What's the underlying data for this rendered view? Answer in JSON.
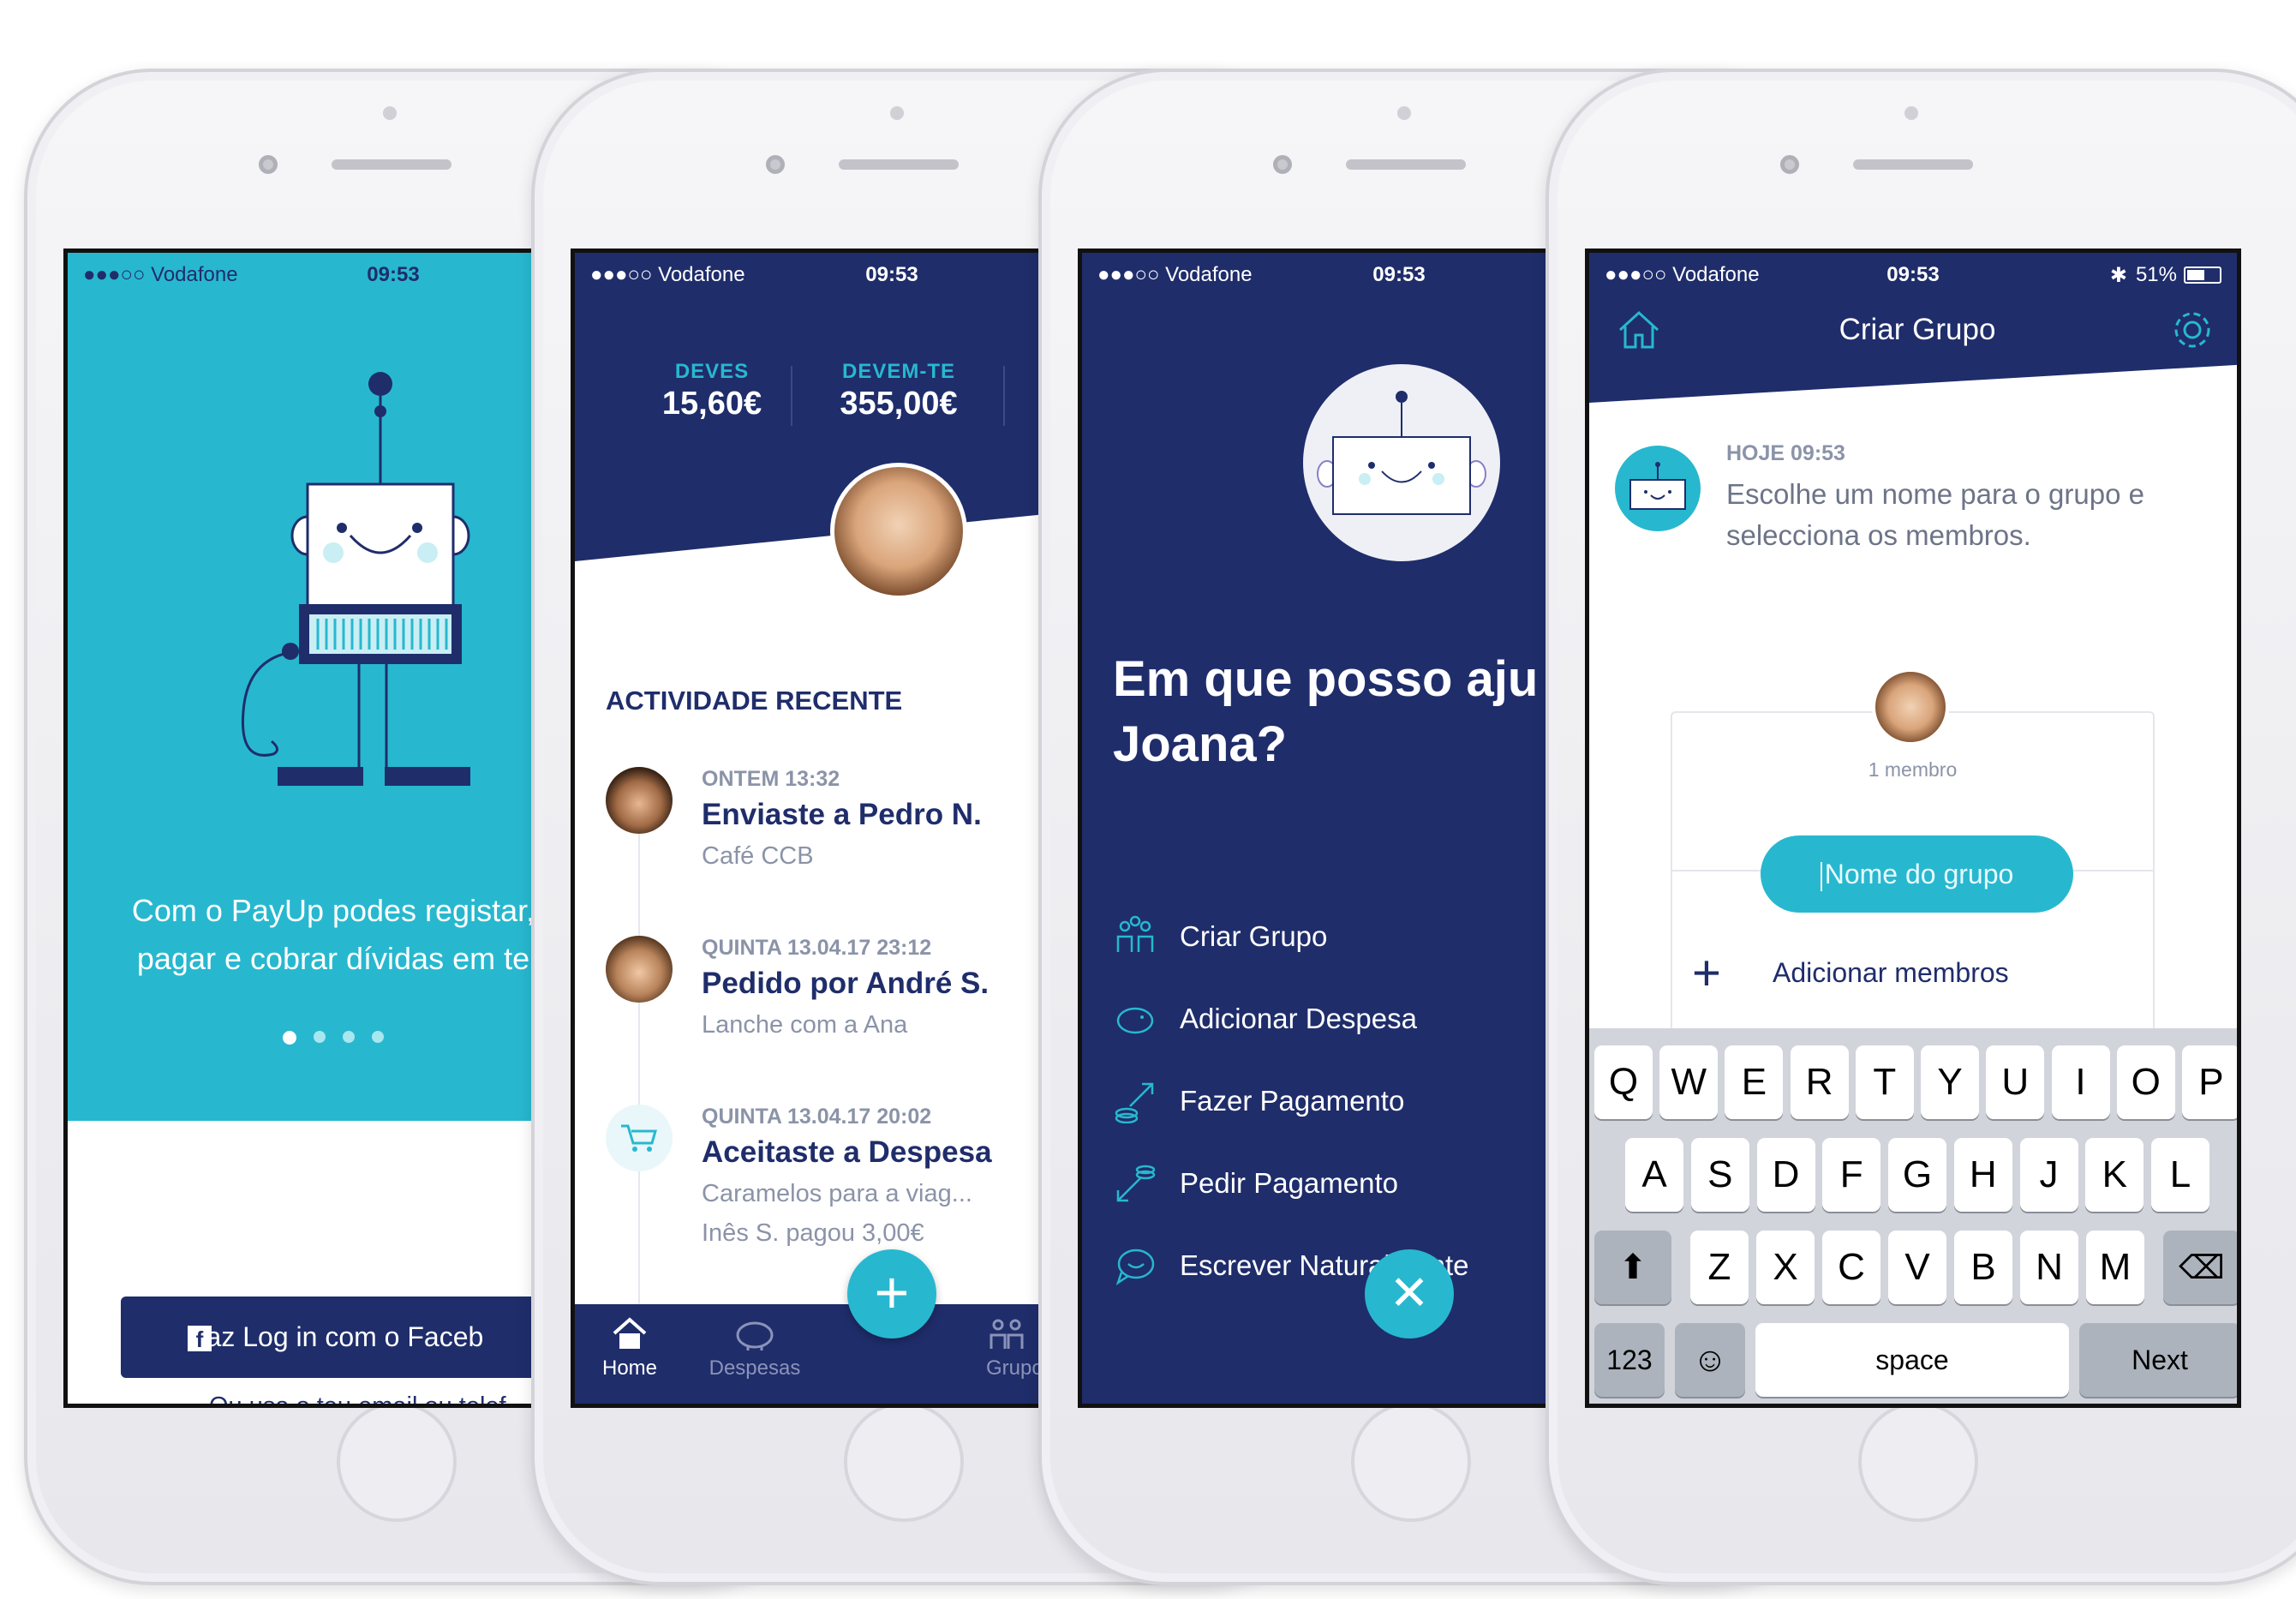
{
  "colors": {
    "teal": "#27b8cf",
    "navy": "#1f2d6b",
    "grey_text": "#8b93a8",
    "light_teal": "#c9eef4"
  },
  "status": {
    "carrier": "●●●○○ Vodafone",
    "time": "09:53",
    "battery": "51%"
  },
  "screen1": {
    "intro_line1": "Com o PayUp podes registar,",
    "intro_line2": "pagar e cobrar dívidas em te",
    "fb_button": "Faz Log in com o Faceb",
    "alt_login": "Ou usa o teu email ou telef"
  },
  "screen2": {
    "owe_label": "DEVES",
    "owe_value": "15,60€",
    "owed_label": "DEVEM-TE",
    "owed_value": "355,00€",
    "section_title": "ACTIVIDADE RECENTE",
    "items": [
      {
        "date": "ONTEM 13:32",
        "title": "Enviaste a Pedro N.",
        "sub": "Café CCB",
        "sub2": ""
      },
      {
        "date": "QUINTA 13.04.17 23:12",
        "title": "Pedido por André S.",
        "sub": "Lanche com a Ana",
        "sub2": ""
      },
      {
        "date": "QUINTA 13.04.17 20:02",
        "title": "Aceitaste a Despesa",
        "sub": "Caramelos para a viag...",
        "sub2": "Inês S. pagou 3,00€"
      }
    ],
    "tabs": {
      "home": "Home",
      "expenses": "Despesas",
      "groups": "Grupo"
    }
  },
  "screen3": {
    "heading1": "Em que posso aju",
    "heading2": "Joana?",
    "menu": [
      "Criar Grupo",
      "Adicionar Despesa",
      "Fazer Pagamento",
      "Pedir Pagamento",
      "Escrever Naturalmente"
    ]
  },
  "screen4": {
    "title": "Criar Grupo",
    "msg_time": "HOJE 09:53",
    "msg_line1": "Escolhe um nome para o grupo e",
    "msg_line2": "selecciona os membros.",
    "members": "1 membro",
    "name_placeholder": "Nome do grupo",
    "add_members": "Adicionar membros",
    "kb_row1": [
      "Q",
      "W",
      "E",
      "R",
      "T",
      "Y",
      "U",
      "I",
      "O",
      "P"
    ],
    "kb_row2": [
      "A",
      "S",
      "D",
      "F",
      "G",
      "H",
      "J",
      "K",
      "L"
    ],
    "kb_row3": [
      "Z",
      "X",
      "C",
      "V",
      "B",
      "N",
      "M"
    ],
    "kb_123": "123",
    "kb_space": "space",
    "kb_next": "Next"
  }
}
